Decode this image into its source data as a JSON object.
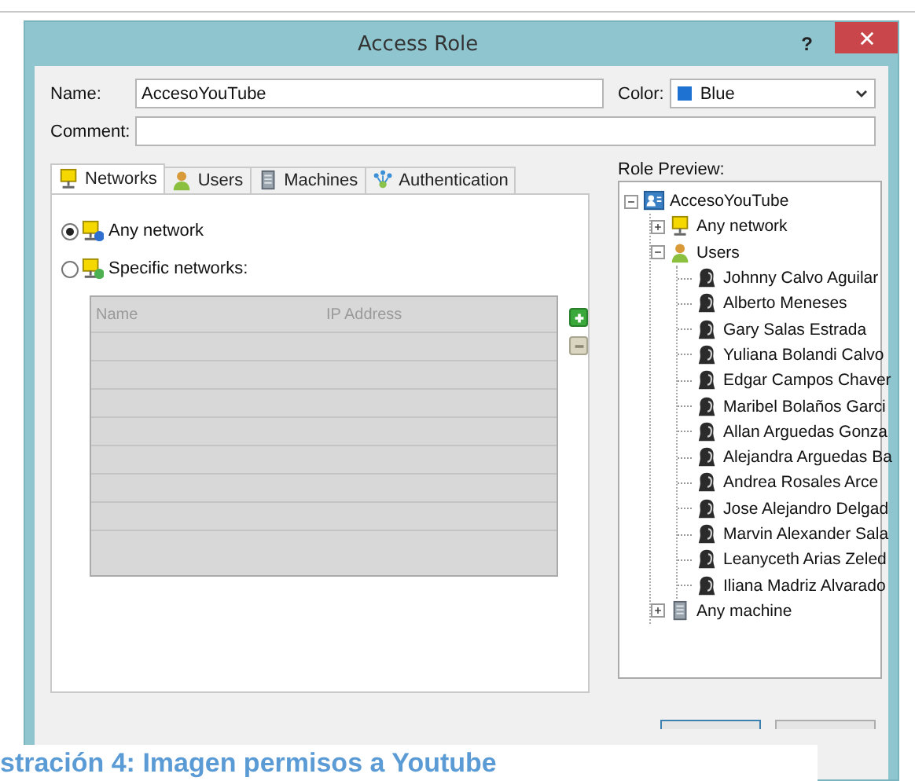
{
  "window": {
    "title": "Access Role",
    "help": "?"
  },
  "form": {
    "name_label": "Name:",
    "name_value": "AccesoYouTube",
    "color_label": "Color:",
    "color_value": "Blue",
    "comment_label": "Comment:"
  },
  "tabs": [
    {
      "label": "Networks",
      "kind": "network",
      "selected": true
    },
    {
      "label": "Users",
      "kind": "users",
      "selected": false
    },
    {
      "label": "Machines",
      "kind": "machine",
      "selected": false
    },
    {
      "label": "Authentication",
      "kind": "auth",
      "selected": false
    }
  ],
  "options": [
    {
      "label": "Any network",
      "kind": "any",
      "selected": true
    },
    {
      "label": "Specific networks:",
      "kind": "specific",
      "selected": false
    }
  ],
  "networks_table": {
    "columns": [
      "Name",
      "IP Address"
    ]
  },
  "preview": {
    "label": "Role Preview:",
    "tree": [
      {
        "label": "AccesoYouTube",
        "kind": "role",
        "expanded": true,
        "children": [
          {
            "label": "Any network",
            "kind": "network",
            "expanded": false
          },
          {
            "label": "Users",
            "kind": "users",
            "expanded": true,
            "children": [
              {
                "label": "Johnny Calvo Aguilar",
                "kind": "person"
              },
              {
                "label": "Alberto Meneses",
                "kind": "person"
              },
              {
                "label": "Gary Salas Estrada",
                "kind": "person"
              },
              {
                "label": "Yuliana Bolandi Calvo",
                "kind": "person"
              },
              {
                "label": "Edgar Campos Chaver",
                "kind": "person"
              },
              {
                "label": "Maribel Bolaños Garci",
                "kind": "person"
              },
              {
                "label": "Allan Arguedas Gonza",
                "kind": "person"
              },
              {
                "label": "Alejandra Arguedas Ba",
                "kind": "person"
              },
              {
                "label": "Andrea Rosales Arce",
                "kind": "person"
              },
              {
                "label": "Jose Alejandro Delgad",
                "kind": "person"
              },
              {
                "label": "Marvin Alexander Sala",
                "kind": "person"
              },
              {
                "label": "Leanyceth Arias Zeled",
                "kind": "person"
              },
              {
                "label": "Iliana Madriz Alvarado",
                "kind": "person"
              }
            ]
          },
          {
            "label": "Any machine",
            "kind": "machine",
            "expanded": false
          }
        ]
      }
    ]
  },
  "caption": "stración 4: Imagen permisos a Youtube"
}
